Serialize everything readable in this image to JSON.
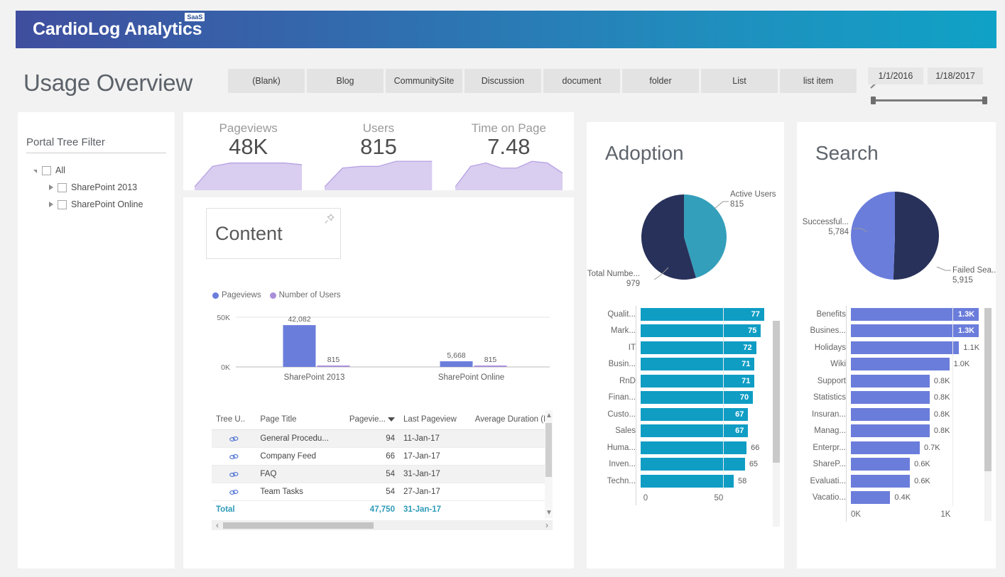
{
  "brand": {
    "name": "CardioLog Analytics",
    "badge": "SaaS"
  },
  "header": {
    "page_title": "Usage Overview",
    "tabs": [
      {
        "label": "(Blank)"
      },
      {
        "label": "Blog"
      },
      {
        "label": "CommunitySite"
      },
      {
        "label": "Discussion"
      },
      {
        "label": "document"
      },
      {
        "label": "folder"
      },
      {
        "label": "List"
      },
      {
        "label": "list item"
      }
    ],
    "next_icon": "chevron-right-icon",
    "date_range": {
      "start": "1/1/2016",
      "end": "1/18/2017"
    }
  },
  "portal_filter": {
    "title": "Portal Tree Filter",
    "nodes": [
      {
        "label": "All",
        "level": 1,
        "expanded": true
      },
      {
        "label": "SharePoint 2013",
        "level": 2,
        "expanded": false
      },
      {
        "label": "SharePoint Online",
        "level": 2,
        "expanded": false
      }
    ]
  },
  "kpis": [
    {
      "label": "Pageviews",
      "value": "48K"
    },
    {
      "label": "Users",
      "value": "815"
    },
    {
      "label": "Time on Page",
      "value": "7.48"
    }
  ],
  "content": {
    "title": "Content",
    "pin_icon": "pin-icon",
    "legend": [
      {
        "label": "Pageviews",
        "color": "#6b7ddb"
      },
      {
        "label": "Number of Users",
        "color": "#a98fd8"
      }
    ],
    "table": {
      "columns": [
        "Tree U..",
        "Page Title",
        "Pagevie...",
        "Last Pageview",
        "Average Duration (Mi"
      ],
      "sorted_column_index": 2,
      "rows": [
        {
          "icon": "link-icon",
          "title": "General Procedu...",
          "pageviews": "94",
          "last": "11-Jan-17",
          "duration": ""
        },
        {
          "icon": "link-icon",
          "title": "Company Feed",
          "pageviews": "66",
          "last": "17-Jan-17",
          "duration": ""
        },
        {
          "icon": "link-icon",
          "title": "FAQ",
          "pageviews": "54",
          "last": "31-Jan-17",
          "duration": ""
        },
        {
          "icon": "link-icon",
          "title": "Team Tasks",
          "pageviews": "54",
          "last": "27-Jan-17",
          "duration": ""
        }
      ],
      "total": {
        "label": "Total",
        "pageviews": "47,750",
        "last": "31-Jan-17"
      }
    }
  },
  "adoption": {
    "title": "Adoption"
  },
  "search": {
    "title": "Search"
  },
  "chart_data": [
    {
      "type": "area",
      "name": "kpi-sparkline-pageviews",
      "title": "Pageviews",
      "values": [
        2,
        14,
        16,
        16,
        16,
        16,
        15
      ],
      "ylim": [
        0,
        20
      ],
      "color": "#d9cdf0"
    },
    {
      "type": "area",
      "name": "kpi-sparkline-users",
      "title": "Users",
      "values": [
        2,
        13,
        14,
        14,
        17,
        17,
        17
      ],
      "ylim": [
        0,
        20
      ],
      "color": "#d9cdf0"
    },
    {
      "type": "area",
      "name": "kpi-sparkline-time-on-page",
      "title": "Time on Page",
      "values": [
        2,
        14,
        16,
        13,
        13,
        17,
        16,
        10
      ],
      "ylim": [
        0,
        20
      ],
      "color": "#d9cdf0"
    },
    {
      "type": "bar",
      "name": "content-bar-chart",
      "title": "Content",
      "categories": [
        "SharePoint 2013",
        "SharePoint Online"
      ],
      "series": [
        {
          "name": "Pageviews",
          "values": [
            42082,
            5668
          ],
          "labels": [
            "42,082",
            "5,668"
          ],
          "color": "#6b7ddb"
        },
        {
          "name": "Number of Users",
          "values": [
            815,
            815
          ],
          "labels": [
            "815",
            "815"
          ],
          "color": "#a98fd8"
        }
      ],
      "ylim": [
        0,
        50000
      ],
      "yticks": [
        0,
        50000
      ],
      "ytick_labels": [
        "0K",
        "50K"
      ],
      "grid": true,
      "legend_position": "top-left"
    },
    {
      "type": "pie",
      "name": "adoption-pie",
      "title": "Adoption",
      "slices": [
        {
          "label": "Active Users",
          "value": 815,
          "value_label": "815",
          "color": "#349fbb"
        },
        {
          "label": "Total Numbe...",
          "value": 979,
          "value_label": "979",
          "color": "#28315a"
        }
      ]
    },
    {
      "type": "pie",
      "name": "search-pie",
      "title": "Search",
      "slices": [
        {
          "label": "Failed Sea...",
          "value": 5915,
          "value_label": "5,915",
          "color": "#28315a"
        },
        {
          "label": "Successful...",
          "value": 5784,
          "value_label": "5,784",
          "color": "#6b7ddb"
        }
      ]
    },
    {
      "type": "bar",
      "name": "adoption-hbar",
      "orientation": "horizontal",
      "title": "Adoption",
      "categories": [
        "Qualit...",
        "Mark...",
        "IT",
        "Busin...",
        "RnD",
        "Finan...",
        "Custo...",
        "Sales",
        "Huma...",
        "Inven...",
        "Techn..."
      ],
      "values": [
        77,
        75,
        72,
        71,
        71,
        70,
        67,
        67,
        66,
        65,
        58
      ],
      "value_labels": [
        "77",
        "75",
        "72",
        "71",
        "71",
        "70",
        "67",
        "67",
        "66",
        "65",
        "58"
      ],
      "label_inside": [
        true,
        true,
        true,
        true,
        true,
        true,
        true,
        true,
        false,
        false,
        false
      ],
      "xlim": [
        0,
        85
      ],
      "xticks": [
        0,
        50
      ],
      "xtick_labels": [
        "0",
        "50"
      ],
      "color": "#0f9dc4"
    },
    {
      "type": "bar",
      "name": "search-hbar",
      "orientation": "horizontal",
      "title": "Search",
      "categories": [
        "Benefits",
        "Busines...",
        "Holidays",
        "Wiki",
        "Support",
        "Statistics",
        "Insuran...",
        "Manag...",
        "Enterpr...",
        "ShareP...",
        "Evaluati...",
        "Vacatio..."
      ],
      "values": [
        1300,
        1300,
        1100,
        1000,
        800,
        800,
        800,
        800,
        700,
        600,
        600,
        400
      ],
      "value_labels": [
        "1.3K",
        "1.3K",
        "1.1K",
        "1.0K",
        "0.8K",
        "0.8K",
        "0.8K",
        "0.8K",
        "0.7K",
        "0.6K",
        "0.6K",
        "0.4K"
      ],
      "label_inside": [
        true,
        true,
        false,
        false,
        false,
        false,
        false,
        false,
        false,
        false,
        false,
        false
      ],
      "xlim": [
        0,
        1400
      ],
      "xticks": [
        0,
        1000
      ],
      "xtick_labels": [
        "0K",
        "1K"
      ],
      "color": "#6b7ddb"
    }
  ]
}
